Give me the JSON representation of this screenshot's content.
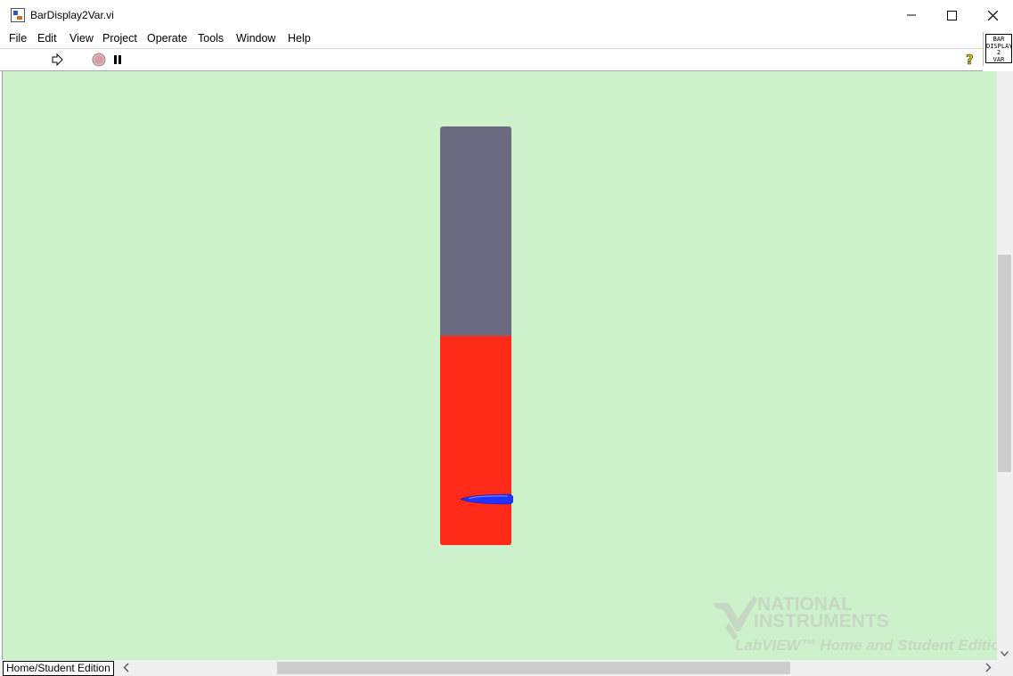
{
  "window": {
    "title": "BarDisplay2Var.vi",
    "icon": "labview-vi-icon"
  },
  "menu": {
    "items": [
      "File",
      "Edit",
      "View",
      "Project",
      "Operate",
      "Tools",
      "Window",
      "Help"
    ]
  },
  "toolbar": {
    "run": "run-arrow-icon",
    "abort": "abort-stop-icon",
    "pause": "pause-icon",
    "help": "help-question-icon",
    "vi_icon_text": [
      "BAR",
      "DISPLAY",
      "2",
      "VAR"
    ]
  },
  "panel": {
    "background": "#cdf1cb",
    "tank": {
      "empty_color": "#6b6a80",
      "fill_color": "#ff2a18",
      "fill_fraction": 0.5
    },
    "slider": {
      "color": "#2233ff",
      "level_fraction": 0.11
    },
    "watermark": {
      "line1": "NATIONAL",
      "line2": "INSTRUMENTS",
      "line3": "LabVIEW™ Home and Student Edition"
    }
  },
  "status": {
    "edition": "Home/Student Edition"
  }
}
